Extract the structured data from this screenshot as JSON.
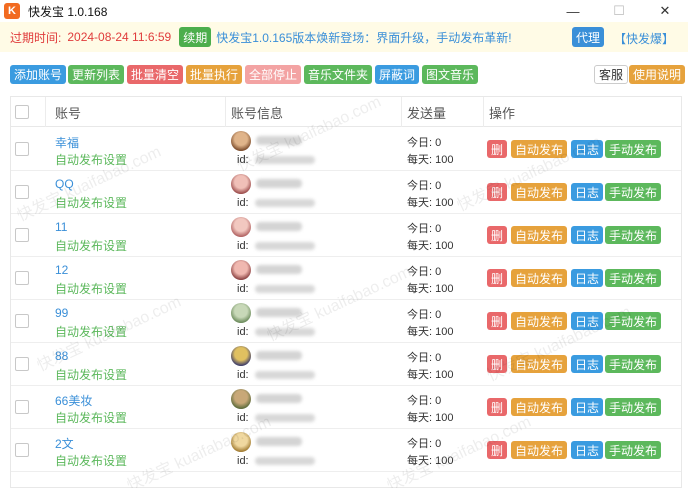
{
  "window": {
    "title": "快发宝 1.0.168",
    "logo_text": "K",
    "controls": {
      "minimize": "—",
      "maximize": "☐",
      "close": "✕"
    }
  },
  "notice": {
    "expire_label": "过期时间:",
    "expire_value": "2024-08-24 11:6:59",
    "renew_label": "续期",
    "announcement": "快发宝1.0.165版本焕新登场：界面升级，手动发布革新!",
    "agent_label": "代理",
    "brand_link": "【快发爆】"
  },
  "toolbar": {
    "add_account": "添加账号",
    "refresh_list": "更新列表",
    "batch_clear": "批量清空",
    "batch_execute": "批量执行",
    "stop_all": "全部停止",
    "music_folder": "音乐文件夹",
    "block_words": "屏蔽词",
    "image_music": "图文音乐",
    "customer_service": "客服",
    "instructions": "使用说明"
  },
  "table": {
    "headers": {
      "account": "账号",
      "account_info": "账号信息",
      "send_count": "发送量",
      "actions": "操作"
    },
    "id_label": "id:",
    "today_label": "今日:",
    "daily_label": "每天:",
    "action_labels": {
      "delete": "删",
      "auto_publish": "自动发布",
      "log": "日志",
      "manual_publish": "手动发布"
    },
    "rows": [
      {
        "name": "幸福",
        "setting": "自动发布设置",
        "today": "0",
        "daily": "100"
      },
      {
        "name": "QQ",
        "setting": "自动发布设置",
        "today": "0",
        "daily": "100"
      },
      {
        "name": "11",
        "setting": "自动发布设置",
        "today": "0",
        "daily": "100"
      },
      {
        "name": "12",
        "setting": "自动发布设置",
        "today": "0",
        "daily": "100"
      },
      {
        "name": "99",
        "setting": "自动发布设置",
        "today": "0",
        "daily": "100"
      },
      {
        "name": "88",
        "setting": "自动发布设置",
        "today": "0",
        "daily": "100"
      },
      {
        "name": "66美妆",
        "setting": "自动发布设置",
        "today": "0",
        "daily": "100"
      },
      {
        "name": "2文",
        "setting": "自动发布设置",
        "today": "0",
        "daily": "100"
      }
    ]
  },
  "watermark_text": "快发宝 kuaifabao.com",
  "colors": {
    "accent_blue": "#3a8fd8",
    "green": "#5cb85c",
    "red": "#e9686a",
    "orange": "#e6a23c",
    "notice_bg": "#fffbe6",
    "expire_red": "#e03c3c"
  }
}
